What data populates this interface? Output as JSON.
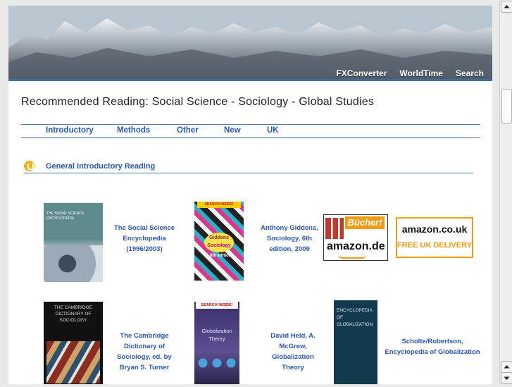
{
  "nav": {
    "fxconverter": "FXConverter",
    "worldtime": "WorldTime",
    "search": "Search"
  },
  "page_title": "Recommended Reading: Social Science - Sociology - Global Studies",
  "tabs": [
    "Introductory",
    "Methods",
    "Other",
    "New",
    "UK"
  ],
  "section": {
    "icon": "lightbulb-icon",
    "title": "General Introductory Reading"
  },
  "books": {
    "b1": {
      "cover_title": "THE SOCIAL SCIENCE ENCYCLOPEDIA",
      "caption": "The Social Science Encyclopedia (1996/2003)"
    },
    "b2": {
      "cover_badge": "SEARCH INSIDE!",
      "cover_title": "Giddens Sociology",
      "edition": "6th edition",
      "caption": "Anthony Giddens, Sociology, 6th edition, 2009"
    },
    "b3": {
      "cover_title": "THE CAMBRIDGE DICTIONARY OF SOCIOLOGY",
      "caption": "The Cambridge Dictionary of Sociology, ed. by Bryan S. Turner"
    },
    "b4": {
      "cover_badge": "SEARCH INSIDE!",
      "cover_title": "Globalization Theory",
      "caption": "David Held, A. McGrew, Globalization Theory"
    },
    "b5": {
      "cover_title": "ENCYCLOPEDIA OF GLOBALIZATION",
      "caption": "Scholte/Robertson, Encyclopedia of Globalization"
    }
  },
  "ads": {
    "amazon_de": {
      "top": "Bücher!",
      "bottom": "amazon.de"
    },
    "amazon_uk": {
      "logo": "amazon.co.uk",
      "tagline": "FREE UK DELIVERY"
    }
  },
  "colors": {
    "link": "#2a56b8",
    "rule": "#5577aa",
    "amazon_orange": "#f39c12"
  }
}
